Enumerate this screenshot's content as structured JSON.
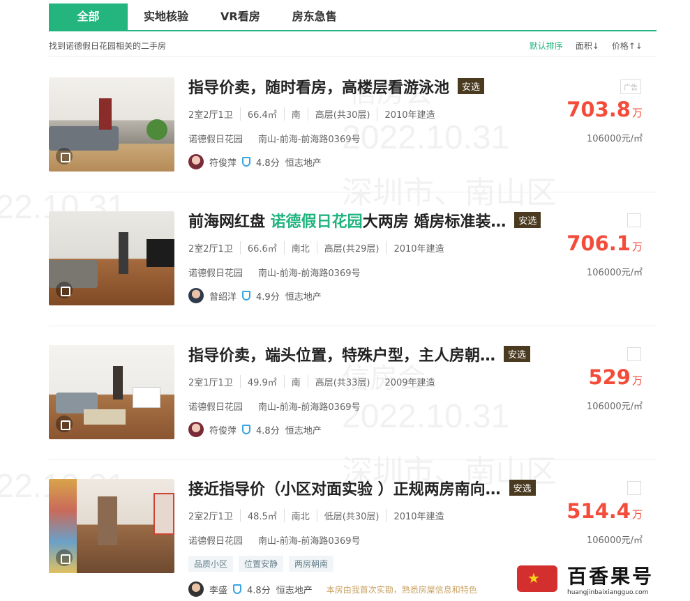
{
  "tabs": [
    "全部",
    "实地核验",
    "VR看房",
    "房东急售"
  ],
  "found_text": "找到诺德假日花园相关的二手房",
  "sort": {
    "default": "默认排序",
    "area": "面积↓",
    "price": "价格↑↓"
  },
  "watermark": {
    "lines": [
      "信房会",
      "2022.10.31",
      "深圳市、南山区"
    ]
  },
  "listings": [
    {
      "title": "指导价卖，随时看房，高楼层看游泳池",
      "badge": "安选",
      "ad": "广告",
      "attrs": [
        "2室2厅1卫",
        "66.4㎡",
        "南",
        "高层(共30层)",
        "2010年建造"
      ],
      "community": "诺德假日花园",
      "address": "南山-前海-前海路0369号",
      "agent": "符俊萍",
      "score": "4.8分",
      "agency": "恒志地产",
      "price": "703.8",
      "price_unit": "万",
      "unit_price": "106000元/㎡"
    },
    {
      "title_pre": "前海网红盘 ",
      "title_hl": "诺德假日花园",
      "title_post": "大两房 婚房标准装…",
      "badge": "安选",
      "attrs": [
        "2室2厅1卫",
        "66.6㎡",
        "南北",
        "高层(共29层)",
        "2010年建造"
      ],
      "community": "诺德假日花园",
      "address": "南山-前海-前海路0369号",
      "agent": "曾绍洋",
      "score": "4.9分",
      "agency": "恒志地产",
      "price": "706.1",
      "price_unit": "万",
      "unit_price": "106000元/㎡"
    },
    {
      "title": "指导价卖，端头位置，特殊户型，主人房朝…",
      "badge": "安选",
      "attrs": [
        "2室1厅1卫",
        "49.9㎡",
        "南",
        "高层(共33层)",
        "2009年建造"
      ],
      "community": "诺德假日花园",
      "address": "南山-前海-前海路0369号",
      "agent": "符俊萍",
      "score": "4.8分",
      "agency": "恒志地产",
      "price": "529",
      "price_unit": "万",
      "unit_price": "106000元/㎡"
    },
    {
      "title": "接近指导价（小区对面实验 ）正规两房南向…",
      "badge": "安选",
      "attrs": [
        "2室2厅1卫",
        "48.5㎡",
        "南北",
        "低层(共30层)",
        "2010年建造"
      ],
      "community": "诺德假日花园",
      "address": "南山-前海-前海路0369号",
      "tags": [
        "品质小区",
        "位置安静",
        "两房朝南"
      ],
      "agent": "李盛",
      "score": "4.8分",
      "agency": "恒志地产",
      "note": "本房由我首次实勘，熟悉房屋信息和特色",
      "price": "514.4",
      "price_unit": "万",
      "unit_price": "106000元/㎡"
    }
  ],
  "logo": {
    "cn": "百香果号",
    "en": "huangjinbaixiangguo.com"
  }
}
